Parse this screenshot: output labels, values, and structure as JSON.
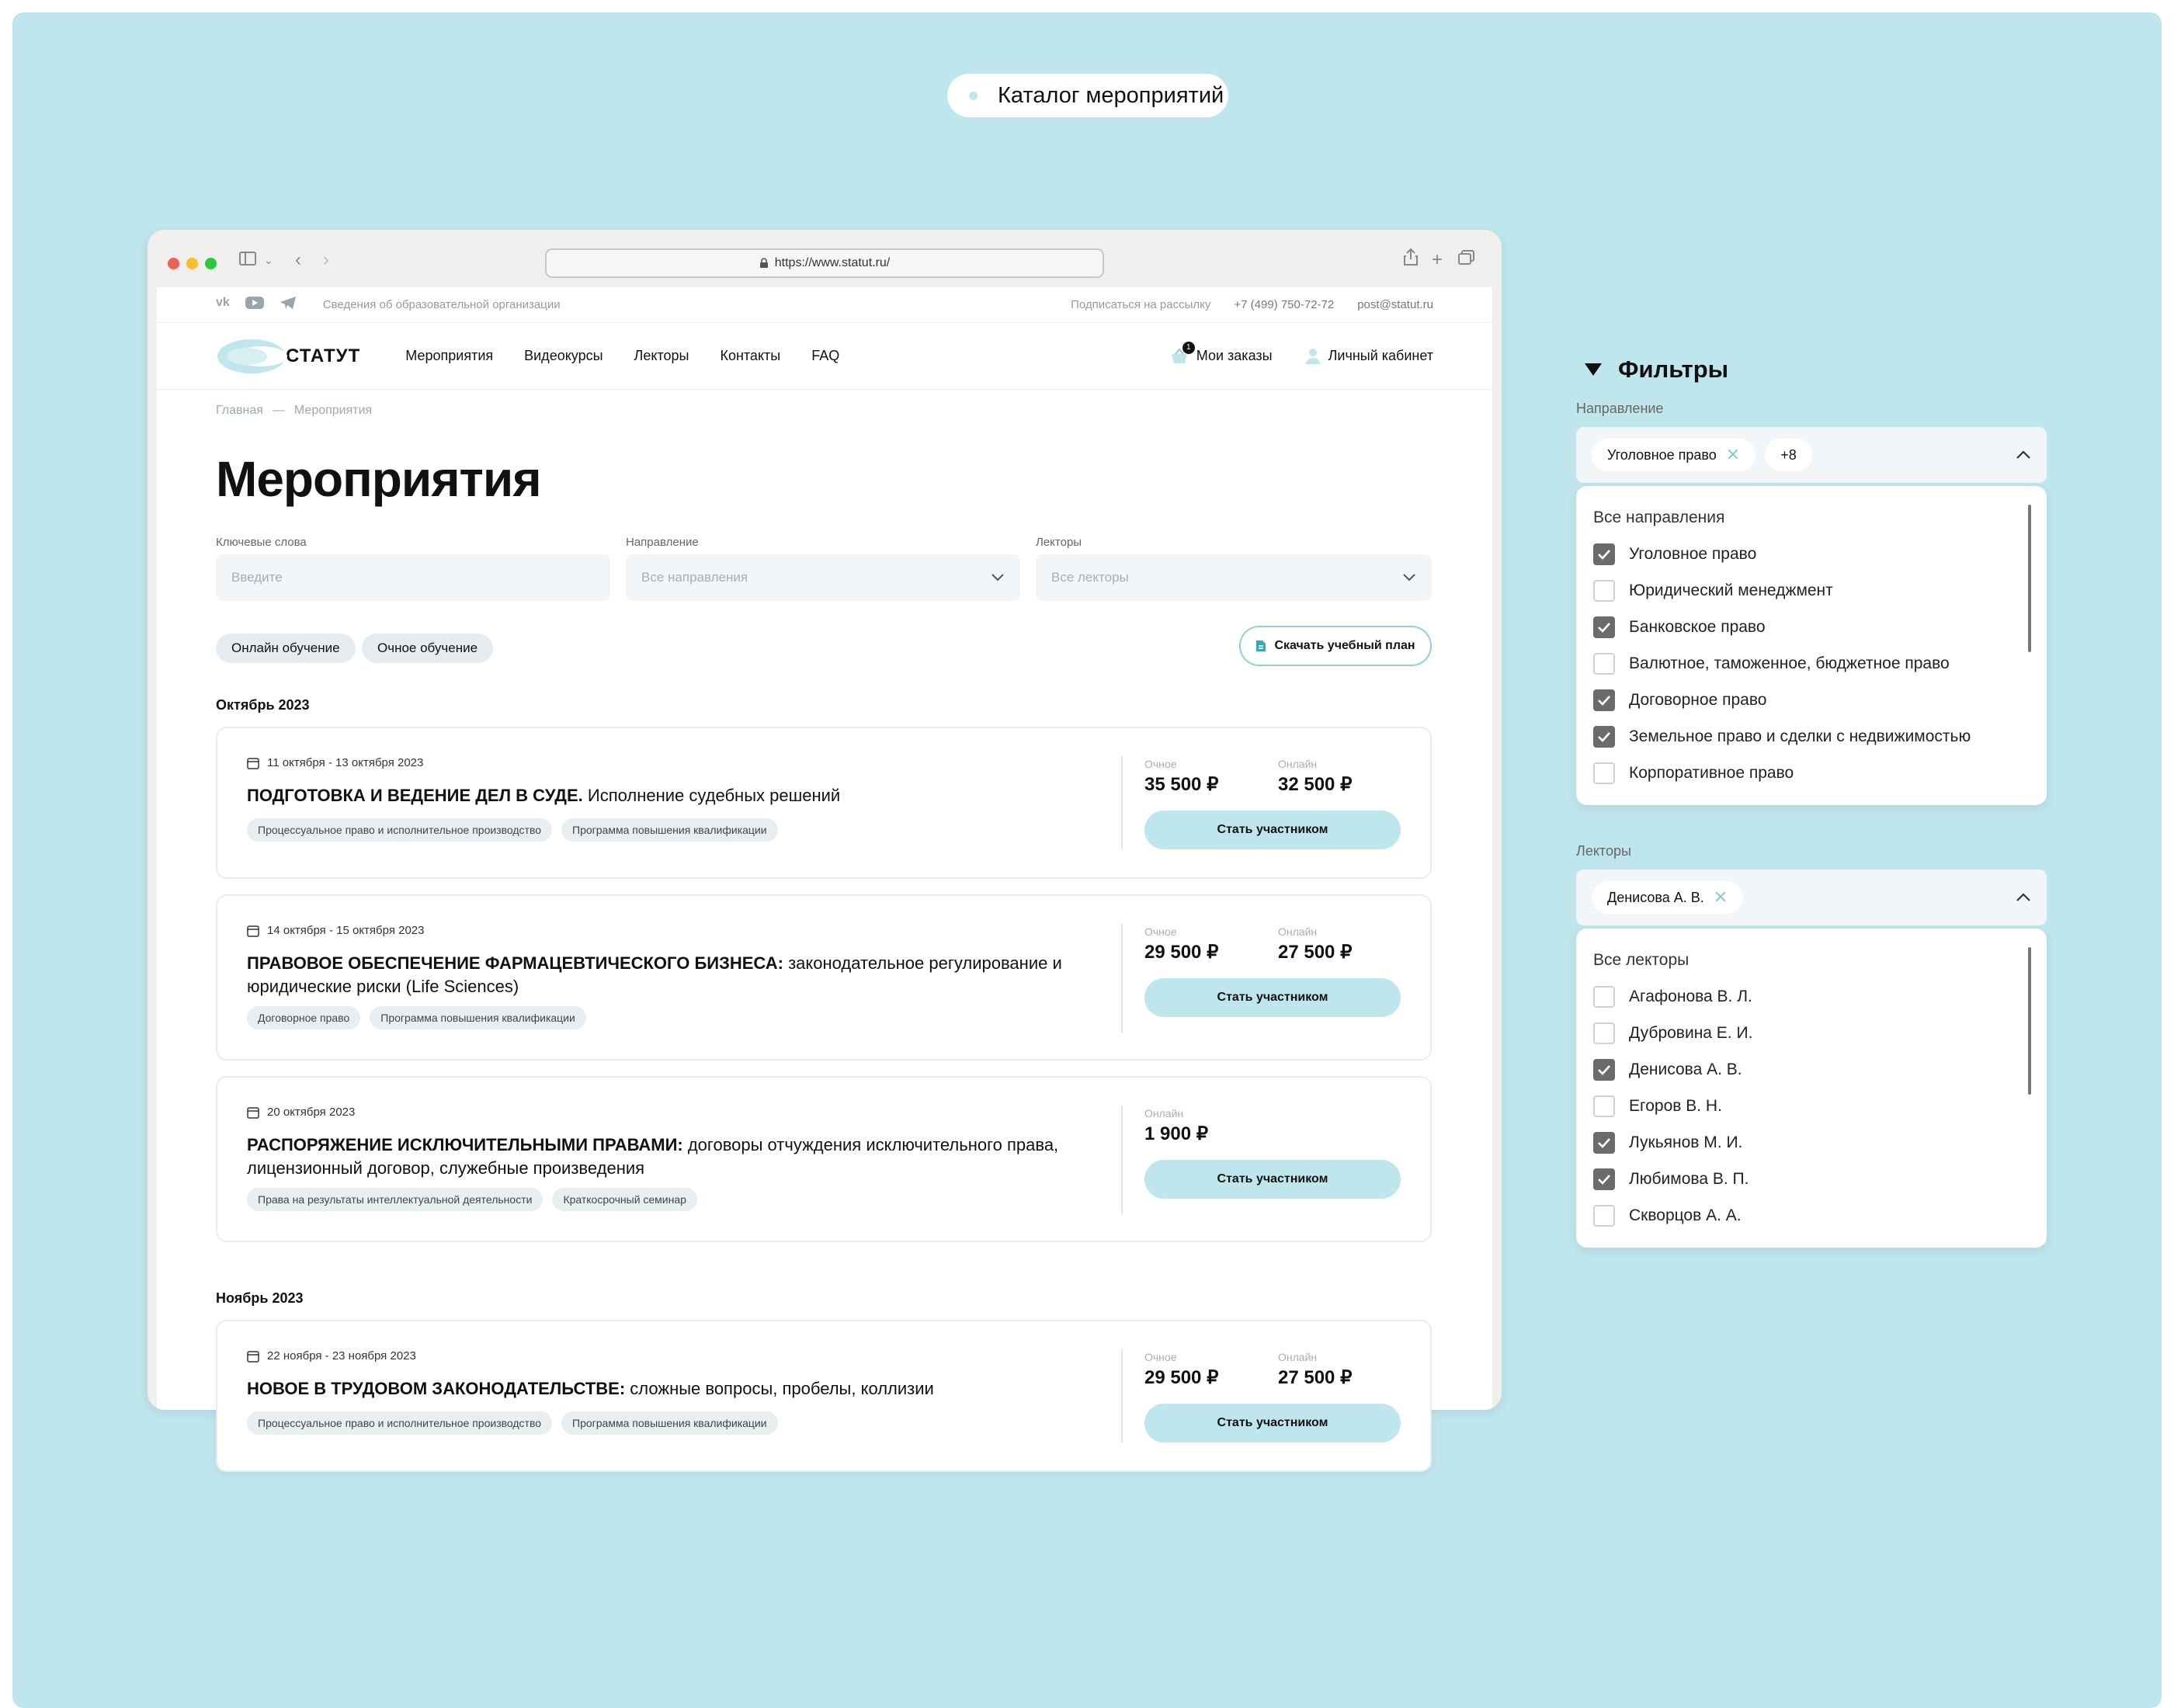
{
  "header_pill": "Каталог мероприятий",
  "browser": {
    "url": "https://www.statut.ru/"
  },
  "topbar": {
    "org_info": "Сведения об образовательной организации",
    "subscribe": "Подписаться на рассылку",
    "phone": "+7 (499) 750-72-72",
    "email": "post@statut.ru"
  },
  "nav": {
    "logo": "СТАТУТ",
    "links": [
      "Мероприятия",
      "Видеокурсы",
      "Лекторы",
      "Контакты",
      "FAQ"
    ],
    "cart_count": "1",
    "orders": "Мои заказы",
    "cabinet": "Личный кабинет"
  },
  "breadcrumb": {
    "home": "Главная",
    "sep": "—",
    "current": "Мероприятия"
  },
  "page_title": "Мероприятия",
  "search_filters": {
    "keywords_label": "Ключевые слова",
    "keywords_placeholder": "Введите",
    "direction_label": "Направление",
    "direction_value": "Все направления",
    "lecturers_label": "Лекторы",
    "lecturers_value": "Все лекторы"
  },
  "chips": [
    "Онлайн обучение",
    "Очное обучение"
  ],
  "download_button": "Скачать учебный план",
  "months": [
    "Октябрь 2023",
    "Ноябрь 2023"
  ],
  "events": [
    {
      "date": "11 октября - 13 октября 2023",
      "title_bold": "ПОДГОТОВКА И ВЕДЕНИЕ ДЕЛ В СУДЕ.",
      "title_rest": " Исполнение судебных решений",
      "tags": [
        "Процессуальное право и исполнительное производство",
        "Программа повышения квалификации"
      ],
      "offline_label": "Очное",
      "offline_price": "35 500 ₽",
      "online_label": "Онлайн",
      "online_price": "32 500 ₽",
      "button": "Стать участником"
    },
    {
      "date": "14 октября - 15 октября 2023",
      "title_bold": "ПРАВОВОЕ ОБЕСПЕЧЕНИЕ ФАРМАЦЕВТИЧЕСКОГО БИЗНЕСА:",
      "title_rest": " законодательное регулирование и юридические риски (Life Sciences)",
      "tags": [
        "Договорное право",
        "Программа повышения квалификации"
      ],
      "offline_label": "Очное",
      "offline_price": "29 500 ₽",
      "online_label": "Онлайн",
      "online_price": "27 500 ₽",
      "button": "Стать участником"
    },
    {
      "date": "20 октября 2023",
      "title_bold": "РАСПОРЯЖЕНИЕ ИСКЛЮЧИТЕЛЬНЫМИ ПРАВАМИ:",
      "title_rest": " договоры отчуждения исключительного права, лицензионный договор, служебные произведения",
      "tags": [
        "Права на результаты интеллектуальной деятельности",
        "Краткосрочный семинар"
      ],
      "online_label": "Онлайн",
      "online_price": "1 900 ₽",
      "button": "Стать участником"
    },
    {
      "date": "22 ноября - 23 ноября 2023",
      "title_bold": "НОВОЕ В ТРУДОВОМ ЗАКОНОДАТЕЛЬСТВЕ:",
      "title_rest": " сложные вопросы, пробелы, коллизии",
      "tags": [
        "Процессуальное право и исполнительное производство",
        "Программа повышения квалификации"
      ],
      "offline_label": "Очное",
      "offline_price": "29 500 ₽",
      "online_label": "Онлайн",
      "online_price": "27 500 ₽",
      "button": "Стать участником"
    }
  ],
  "filters": {
    "title": "Фильтры",
    "direction": {
      "label": "Направление",
      "selected_tag": "Уголовное право",
      "more": "+8",
      "all": "Все направления",
      "options": [
        {
          "label": "Уголовное право",
          "checked": true
        },
        {
          "label": "Юридический менеджмент",
          "checked": false
        },
        {
          "label": "Банковское право",
          "checked": true
        },
        {
          "label": "Валютное, таможенное, бюджетное право",
          "checked": false
        },
        {
          "label": "Договорное право",
          "checked": true
        },
        {
          "label": "Земельное право и сделки с недвижимостью",
          "checked": true
        },
        {
          "label": "Корпоративное право",
          "checked": false
        }
      ]
    },
    "lecturers": {
      "label": "Лекторы",
      "selected_tag": "Денисова А. В.",
      "all": "Все лекторы",
      "options": [
        {
          "label": "Агафонова В. Л.",
          "checked": false
        },
        {
          "label": "Дубровина Е. И.",
          "checked": false
        },
        {
          "label": "Денисова А. В.",
          "checked": true
        },
        {
          "label": "Егоров В. Н.",
          "checked": false
        },
        {
          "label": "Лукьянов М. И.",
          "checked": true
        },
        {
          "label": "Любимова В. П.",
          "checked": true
        },
        {
          "label": "Скворцов А. А.",
          "checked": false
        }
      ]
    }
  },
  "colors": {
    "accent": "#bfe6ec",
    "background": "#bfe6ec",
    "checkbox_on": "#6b6b6b"
  }
}
